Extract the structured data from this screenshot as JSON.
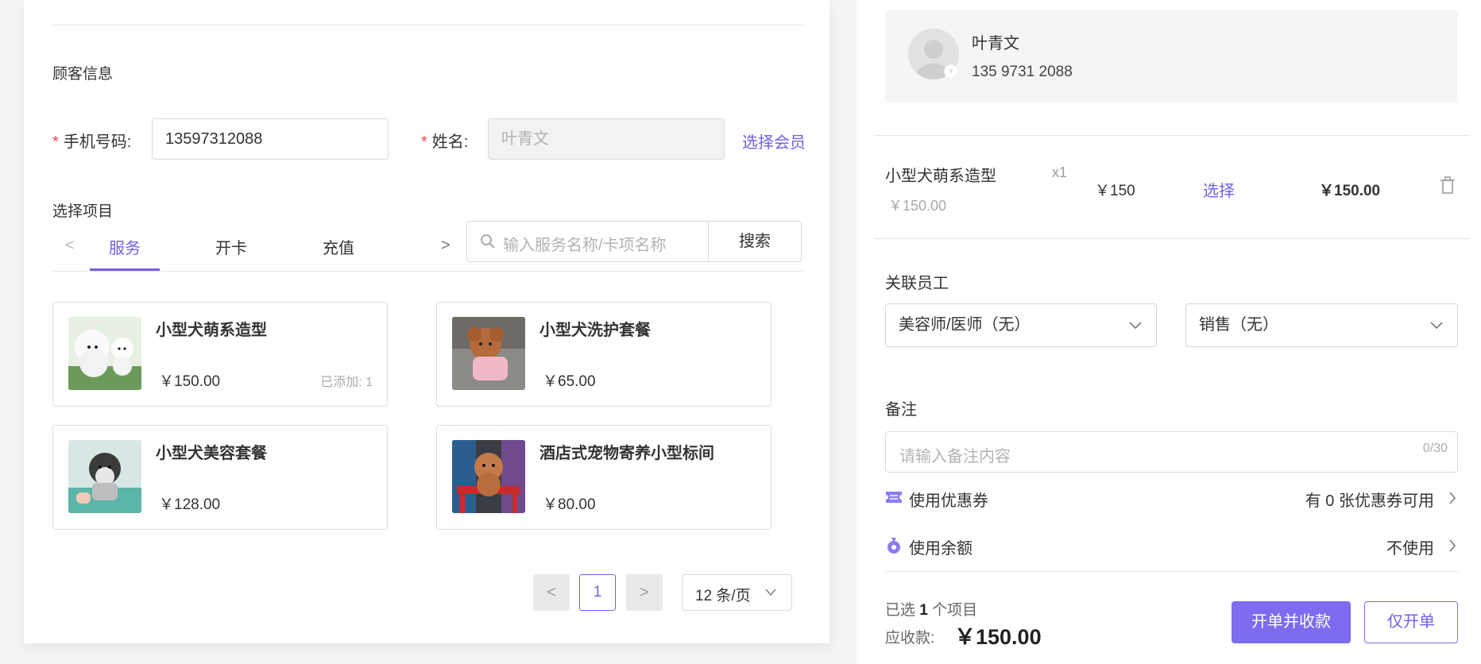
{
  "customer": {
    "section_title": "顾客信息",
    "phone_label": "手机号码:",
    "phone_value": "13597312088",
    "name_label": "姓名:",
    "name_placeholder": "叶青文",
    "select_member": "选择会员",
    "required_mark": "*"
  },
  "items_section": {
    "title": "选择项目",
    "tabs": [
      {
        "label": "服务",
        "active": true
      },
      {
        "label": "开卡",
        "active": false
      },
      {
        "label": "充值",
        "active": false
      }
    ],
    "search_placeholder": "输入服务名称/卡项名称",
    "search_button": "搜索"
  },
  "products": [
    {
      "name": "小型犬萌系造型",
      "price": "￥150.00",
      "added": "已添加: 1"
    },
    {
      "name": "小型犬洗护套餐",
      "price": "￥65.00",
      "added": ""
    },
    {
      "name": "小型犬美容套餐",
      "price": "￥128.00",
      "added": ""
    },
    {
      "name": "酒店式宠物寄养小型标间",
      "price": "￥80.00",
      "added": ""
    }
  ],
  "pagination": {
    "current_page": "1",
    "prev": "<",
    "next": ">",
    "page_size": "12 条/页"
  },
  "member": {
    "name": "叶青文",
    "phone": "135 9731 2088"
  },
  "order_line": {
    "name": "小型犬萌系造型",
    "qty": "x1",
    "original_price": "￥150.00",
    "unit_price": "￥150",
    "select_label": "选择",
    "subtotal": "￥150.00"
  },
  "staff": {
    "title": "关联员工",
    "groomer": "美容师/医师（无）",
    "sales": "销售（无）"
  },
  "remark": {
    "title": "备注",
    "placeholder": "请输入备注内容",
    "counter": "0/30"
  },
  "coupon": {
    "label": "使用优惠券",
    "value": "有 0 张优惠券可用"
  },
  "balance": {
    "label": "使用余额",
    "value": "不使用"
  },
  "summary": {
    "selected_prefix": "已选",
    "selected_count": "1",
    "selected_suffix": "个项目",
    "due_label": "应收款:",
    "due_amount": "￥150.00"
  },
  "actions": {
    "checkout": "开单并收款",
    "order_only": "仅开单"
  },
  "colors": {
    "accent": "#7160e8",
    "required": "#f04848"
  }
}
